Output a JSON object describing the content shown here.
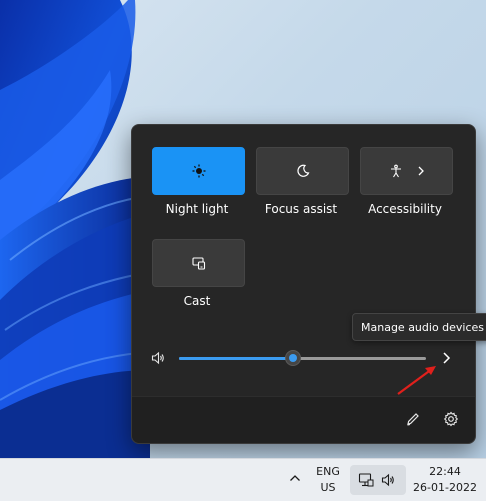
{
  "quick_settings": {
    "tiles": [
      {
        "label": "Night light",
        "icon": "night-light-icon",
        "active": true
      },
      {
        "label": "Focus assist",
        "icon": "moon-icon",
        "active": false
      },
      {
        "label": "Accessibility",
        "icon": "accessibility-icon",
        "active": false
      },
      {
        "label": "Cast",
        "icon": "cast-icon",
        "active": false
      }
    ],
    "volume": {
      "level_percent": 46,
      "icon": "speaker-icon",
      "more_icon": "chevron-right-icon"
    },
    "tooltip": "Manage audio devices",
    "footer": {
      "edit_icon": "pencil-icon",
      "settings_icon": "gear-icon"
    },
    "accent": "#1a93f5"
  },
  "taskbar": {
    "overflow_icon": "chevron-up-icon",
    "language_line1": "ENG",
    "language_line2": "US",
    "tray_icons": [
      "network-icon",
      "speaker-icon"
    ],
    "time": "22:44",
    "date": "26-01-2022"
  },
  "annotation": {
    "arrow_color": "#e0201c"
  }
}
